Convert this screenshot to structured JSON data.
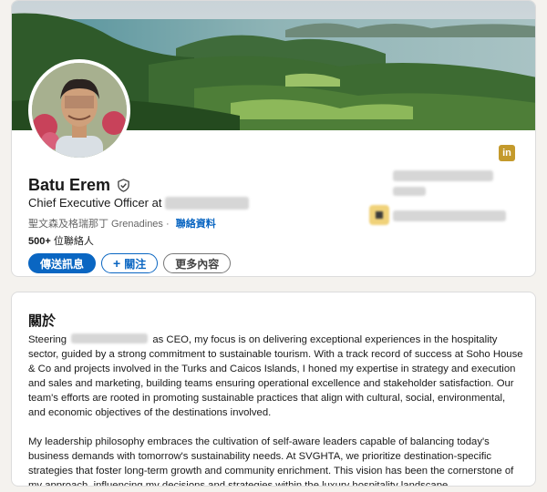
{
  "profile": {
    "name": "Batu Erem",
    "headline_prefix": "Chief Executive Officer at",
    "location": "聖文森及格瑞那丁 Grenadines",
    "contact_link": "聯絡資料",
    "connections_count": "500+",
    "connections_suffix": "位聯絡人",
    "linkedin_badge": "in"
  },
  "actions": {
    "message_label": "傳送訊息",
    "follow_label": "關注",
    "more_label": "更多內容"
  },
  "about": {
    "title": "關於",
    "para1_start": "Steering",
    "para1_rest": "as CEO, my focus is on delivering exceptional experiences in the hospitality sector, guided by a strong commitment to sustainable tourism. With a track record of success at Soho House & Co and projects involved in the Turks and Caicos Islands, I honed my expertise in strategy and execution and sales and marketing, building teams ensuring operational excellence and stakeholder satisfaction. Our team's efforts are rooted in promoting sustainable practices that align with cultural, social, environmental, and economic objectives of the destinations involved.",
    "para2": "My leadership philosophy embraces the cultivation of self-aware leaders capable of balancing today's business demands with tomorrow's sustainability needs. At SVGHTA, we prioritize destination-specific strategies that foster long-term growth and community enrichment. This vision has been the cornerstone of my approach, influencing my decisions and strategies within the luxury hospitality landscape."
  },
  "icons": {
    "verified": "shield-check-icon",
    "plus": "plus-icon",
    "linkedin": "linkedin-icon"
  },
  "colors": {
    "brand_blue": "#0a66c2",
    "badge_gold": "#c49a2c",
    "page_bg": "#f4f2ee"
  }
}
